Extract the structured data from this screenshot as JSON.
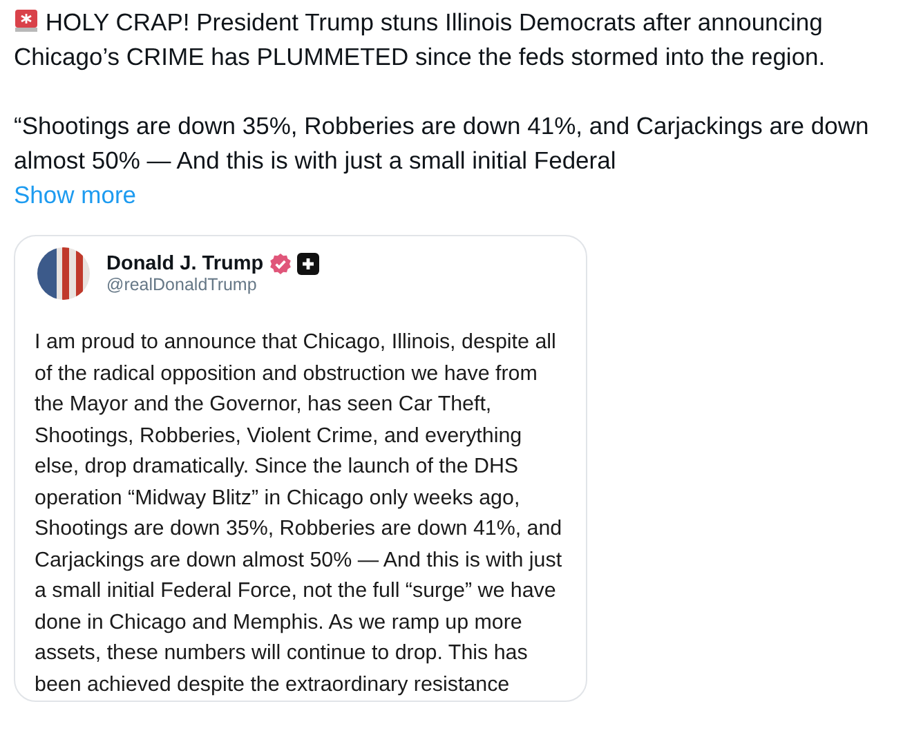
{
  "post": {
    "text": "HOLY CRAP! President Trump stuns Illinois Democrats after announcing Chicago’s CRIME has PLUMMETED since the feds stormed into the region.",
    "quote": "“Shootings are down 35%, Robberies are down 41%, and Carjackings are down almost 50% — And this is with just a small initial Federal",
    "show_more": "Show more"
  },
  "embedded_post": {
    "name": "Donald J. Trump",
    "verified": true,
    "handle": "@realDonaldTrump",
    "body": "I am proud to announce that Chicago, Illinois, despite all of the radical opposition and obstruction we have from the Mayor and the Governor, has seen Car Theft, Shootings, Robberies, Violent Crime, and everything else, drop dramatically. Since the launch of the DHS operation “Midway Blitz” in Chicago only weeks ago, Shootings are down 35%, Robberies are down 41%, and Carjackings are down almost 50% — And this is with just a small initial Federal Force, not the full “surge” we have done in Chicago and Memphis. As we ramp up more assets, these numbers will continue to drop. This has been achieved despite the extraordinary resistance"
  }
}
